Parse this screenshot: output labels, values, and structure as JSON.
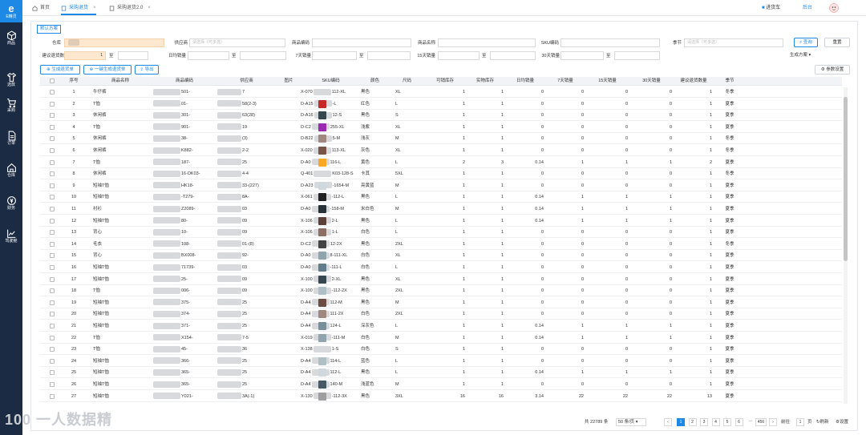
{
  "sidebar": {
    "logo_glyph": "e",
    "logo_label": "E精灵",
    "items": [
      {
        "label": "商品",
        "icon": "cube-icon"
      },
      {
        "label": "选款",
        "icon": "shirt-icon"
      },
      {
        "label": "采购",
        "icon": "cart-icon"
      },
      {
        "label": "订单",
        "icon": "document-icon"
      },
      {
        "label": "仓库",
        "icon": "home-icon"
      },
      {
        "label": "财务",
        "icon": "money-icon"
      },
      {
        "label": "驾驶舱",
        "icon": "chart-icon"
      }
    ]
  },
  "topbar": {
    "tabs": [
      {
        "label": "首页"
      },
      {
        "label": "采购退货"
      },
      {
        "label": "采购退货2.0"
      }
    ],
    "right_items": [
      "进货车",
      "后台"
    ]
  },
  "scheme_tab": "默认方案",
  "filters": {
    "warehouse_label": "仓库",
    "supplier_label": "供应商",
    "supplier_placeholder": "请选择（可多选）",
    "product_code_label": "商品编码",
    "product_name_label": "商品名称",
    "sku_label": "SKU编码",
    "season_label": "季节",
    "season_placeholder": "请选择（可多选）",
    "suggest_qty_label": "建议退货数",
    "suggest_min": "1",
    "range_sep": "至",
    "daily_sales_label": "日均销量",
    "sales7_label": "7天销量",
    "sales15_label": "15天销量",
    "sales30_label": "30天销量"
  },
  "buttons": {
    "search": "查询",
    "reset": "重置",
    "generate_plan": "生成方案",
    "generate_order": "生成退货单",
    "generate_one_click": "一键生成退货单",
    "export": "导出",
    "param_settings": "参数设置"
  },
  "table": {
    "headers": [
      "序号",
      "商品名称",
      "商品编码",
      "供应商",
      "图片",
      "SKU编码",
      "颜色",
      "尺码",
      "可销库存",
      "实物库存",
      "日均销量",
      "7天销量",
      "15天销量",
      "30天销量",
      "建议退货数量",
      "季节"
    ],
    "rows": [
      {
        "no": "1",
        "name": "牛仔裤",
        "code": "501-",
        "supplier": "7",
        "sku_pre": "X-070",
        "sku_suf": "112-XL",
        "color": "黑色",
        "size": "XL",
        "avail": "1",
        "phys": "1",
        "daily": "0",
        "s7": "0",
        "s15": "0",
        "s30": "0",
        "suggest": "1",
        "season": "冬季"
      },
      {
        "no": "2",
        "name": "T恤",
        "code": "01-",
        "supplier": "58(2-3)",
        "sku_pre": "D-A15",
        "sku_suf": "-L",
        "color": "红色",
        "size": "L",
        "avail": "1",
        "phys": "1",
        "daily": "0",
        "s7": "0",
        "s15": "0",
        "s30": "0",
        "suggest": "1",
        "season": "夏季"
      },
      {
        "no": "3",
        "name": "休闲裤",
        "code": "301-",
        "supplier": "63(28)",
        "sku_pre": "D-A16",
        "sku_suf": "12-S",
        "color": "黑色",
        "size": "S",
        "avail": "1",
        "phys": "1",
        "daily": "0",
        "s7": "0",
        "s15": "0",
        "s30": "0",
        "suggest": "1",
        "season": "夏季"
      },
      {
        "no": "4",
        "name": "T恤",
        "code": "901-",
        "supplier": "19",
        "sku_pre": "D-C2",
        "sku_suf": "255-XL",
        "color": "浅紫",
        "size": "XL",
        "avail": "1",
        "phys": "1",
        "daily": "0",
        "s7": "0",
        "s15": "0",
        "s30": "0",
        "suggest": "1",
        "season": "夏季"
      },
      {
        "no": "5",
        "name": "休闲裤",
        "code": "38-",
        "supplier": "(3)",
        "sku_pre": "D-B22",
        "sku_suf": "5-M",
        "color": "浅灰",
        "size": "M",
        "avail": "1",
        "phys": "1",
        "daily": "0",
        "s7": "0",
        "s15": "0",
        "s30": "0",
        "suggest": "1",
        "season": "冬季"
      },
      {
        "no": "6",
        "name": "休闲裤",
        "code": "K882-",
        "supplier": "2-2",
        "sku_pre": "X-020",
        "sku_suf": "113-XL",
        "color": "灰色",
        "size": "XL",
        "avail": "1",
        "phys": "1",
        "daily": "0",
        "s7": "0",
        "s15": "0",
        "s30": "0",
        "suggest": "1",
        "season": "冬季"
      },
      {
        "no": "7",
        "name": "T恤",
        "code": "187-",
        "supplier": "25",
        "sku_pre": "D-A0",
        "sku_suf": "116-L",
        "color": "黄色",
        "size": "L",
        "avail": "2",
        "phys": "3",
        "daily": "0.14",
        "s7": "1",
        "s15": "1",
        "s30": "1",
        "suggest": "2",
        "season": "夏季"
      },
      {
        "no": "8",
        "name": "休闲裤",
        "code": "16-DK03-",
        "supplier": "4-4",
        "sku_pre": "Q-401",
        "sku_suf": "K03-128-S",
        "color": "卡其",
        "size": "5XL",
        "avail": "1",
        "phys": "1",
        "daily": "0",
        "s7": "0",
        "s15": "0",
        "s30": "0",
        "suggest": "1",
        "season": "冬季"
      },
      {
        "no": "9",
        "name": "短袖T恤",
        "code": "HK18-",
        "supplier": "33-(227)",
        "sku_pre": "D-A23",
        "sku_suf": "-1654-M",
        "color": "亮黄蓝",
        "size": "M",
        "avail": "1",
        "phys": "1",
        "daily": "0",
        "s7": "0",
        "s15": "0",
        "s30": "0",
        "suggest": "1",
        "season": "夏季"
      },
      {
        "no": "10",
        "name": "短袖T恤",
        "code": "-T279-",
        "supplier": "8A-",
        "sku_pre": "X-061",
        "sku_suf": "-112-L",
        "color": "黑色",
        "size": "L",
        "avail": "1",
        "phys": "1",
        "daily": "0.14",
        "s7": "1",
        "s15": "1",
        "s30": "1",
        "suggest": "1",
        "season": "夏季"
      },
      {
        "no": "11",
        "name": "衬衫",
        "code": "Z2089-",
        "supplier": "03",
        "sku_pre": "D-A0",
        "sku_suf": "-158-M",
        "color": "米白色",
        "size": "M",
        "avail": "1",
        "phys": "1",
        "daily": "0.14",
        "s7": "1",
        "s15": "1",
        "s30": "1",
        "suggest": "1",
        "season": "夏季"
      },
      {
        "no": "12",
        "name": "短袖T恤",
        "code": "80-",
        "supplier": "09",
        "sku_pre": "X-106",
        "sku_suf": "2-L",
        "color": "黑色",
        "size": "L",
        "avail": "1",
        "phys": "1",
        "daily": "0.14",
        "s7": "1",
        "s15": "1",
        "s30": "1",
        "suggest": "1",
        "season": "夏季"
      },
      {
        "no": "13",
        "name": "背心",
        "code": "10-",
        "supplier": "09",
        "sku_pre": "X-106",
        "sku_suf": "1-L",
        "color": "白色",
        "size": "L",
        "avail": "1",
        "phys": "1",
        "daily": "0",
        "s7": "0",
        "s15": "0",
        "s30": "0",
        "suggest": "1",
        "season": "夏季"
      },
      {
        "no": "14",
        "name": "毛衣",
        "code": "108-",
        "supplier": "01-(8)",
        "sku_pre": "D-C2",
        "sku_suf": "12-2X",
        "color": "黑色",
        "size": "2XL",
        "avail": "1",
        "phys": "1",
        "daily": "0",
        "s7": "0",
        "s15": "0",
        "s30": "0",
        "suggest": "1",
        "season": "冬季"
      },
      {
        "no": "15",
        "name": "背心",
        "code": "BX008-",
        "supplier": "92-",
        "sku_pre": "D-A0",
        "sku_suf": "8-111-XL",
        "color": "白色",
        "size": "XL",
        "avail": "1",
        "phys": "1",
        "daily": "0",
        "s7": "0",
        "s15": "0",
        "s30": "0",
        "suggest": "1",
        "season": "夏季"
      },
      {
        "no": "16",
        "name": "短袖T恤",
        "code": "71739-",
        "supplier": "03",
        "sku_pre": "D-A0",
        "sku_suf": "-111-L",
        "color": "白色",
        "size": "L",
        "avail": "1",
        "phys": "1",
        "daily": "0",
        "s7": "0",
        "s15": "0",
        "s30": "0",
        "suggest": "1",
        "season": "夏季"
      },
      {
        "no": "17",
        "name": "短袖T恤",
        "code": "25-",
        "supplier": "09",
        "sku_pre": "X-100",
        "sku_suf": "2-XL",
        "color": "黑色",
        "size": "XL",
        "avail": "1",
        "phys": "1",
        "daily": "0",
        "s7": "0",
        "s15": "0",
        "s30": "0",
        "suggest": "1",
        "season": "夏季"
      },
      {
        "no": "18",
        "name": "T恤",
        "code": "006-",
        "supplier": "09",
        "sku_pre": "X-100",
        "sku_suf": "-112-2X",
        "color": "黑色",
        "size": "2XL",
        "avail": "1",
        "phys": "1",
        "daily": "0",
        "s7": "0",
        "s15": "0",
        "s30": "0",
        "suggest": "1",
        "season": "夏季"
      },
      {
        "no": "19",
        "name": "短袖T恤",
        "code": "375-",
        "supplier": "25",
        "sku_pre": "D-A4",
        "sku_suf": "112-M",
        "color": "黑色",
        "size": "M",
        "avail": "1",
        "phys": "1",
        "daily": "0",
        "s7": "0",
        "s15": "0",
        "s30": "0",
        "suggest": "1",
        "season": "夏季"
      },
      {
        "no": "20",
        "name": "短袖T恤",
        "code": "374-",
        "supplier": "25",
        "sku_pre": "D-A4",
        "sku_suf": "111-2X",
        "color": "白色",
        "size": "2XL",
        "avail": "1",
        "phys": "1",
        "daily": "0",
        "s7": "0",
        "s15": "0",
        "s30": "0",
        "suggest": "1",
        "season": "夏季"
      },
      {
        "no": "21",
        "name": "短袖T恤",
        "code": "371-",
        "supplier": "25",
        "sku_pre": "D-A4",
        "sku_suf": "124-L",
        "color": "深灰色",
        "size": "L",
        "avail": "1",
        "phys": "1",
        "daily": "0.14",
        "s7": "1",
        "s15": "1",
        "s30": "1",
        "suggest": "1",
        "season": "夏季"
      },
      {
        "no": "22",
        "name": "T恤",
        "code": "X154-",
        "supplier": "7-5",
        "sku_pre": "X-019",
        "sku_suf": "-111-M",
        "color": "白色",
        "size": "M",
        "avail": "1",
        "phys": "1",
        "daily": "0.14",
        "s7": "1",
        "s15": "1",
        "s30": "1",
        "suggest": "1",
        "season": "夏季"
      },
      {
        "no": "23",
        "name": "T恤",
        "code": "45-",
        "supplier": "36",
        "sku_pre": "X-138",
        "sku_suf": "1-S",
        "color": "白色",
        "size": "S",
        "avail": "1",
        "phys": "1",
        "daily": "0",
        "s7": "0",
        "s15": "0",
        "s30": "0",
        "suggest": "1",
        "season": "夏季"
      },
      {
        "no": "24",
        "name": "短袖T恤",
        "code": "366-",
        "supplier": "25",
        "sku_pre": "D-A4",
        "sku_suf": "114-L",
        "color": "蓝色",
        "size": "L",
        "avail": "1",
        "phys": "1",
        "daily": "0",
        "s7": "0",
        "s15": "0",
        "s30": "0",
        "suggest": "1",
        "season": "夏季"
      },
      {
        "no": "25",
        "name": "短袖T恤",
        "code": "365-",
        "supplier": "25",
        "sku_pre": "D-A4",
        "sku_suf": "112-L",
        "color": "黑色",
        "size": "L",
        "avail": "1",
        "phys": "1",
        "daily": "0.14",
        "s7": "1",
        "s15": "1",
        "s30": "1",
        "suggest": "1",
        "season": "夏季"
      },
      {
        "no": "26",
        "name": "短袖T恤",
        "code": "365-",
        "supplier": "25",
        "sku_pre": "D-A4",
        "sku_suf": "140-M",
        "color": "浅蓝色",
        "size": "M",
        "avail": "1",
        "phys": "1",
        "daily": "0",
        "s7": "0",
        "s15": "0",
        "s30": "0",
        "suggest": "1",
        "season": "夏季"
      },
      {
        "no": "27",
        "name": "短袖T恤",
        "code": "Y021-",
        "supplier": "3A(-1)",
        "sku_pre": "X-130",
        "sku_suf": "-112-3X",
        "color": "黑色",
        "size": "3XL",
        "avail": "16",
        "phys": "16",
        "daily": "3.14",
        "s7": "22",
        "s15": "22",
        "s30": "22",
        "suggest": "13",
        "season": "夏季"
      }
    ]
  },
  "pagination": {
    "total": "共 22789 条",
    "page_size": "50 条/页",
    "pages": [
      "1",
      "2",
      "3",
      "4",
      "5",
      "6"
    ],
    "ellipsis": "···",
    "last_page": "456",
    "goto_label": "前往",
    "goto_value": "1",
    "page_unit": "页",
    "refresh": "刷新",
    "settings": "设置"
  },
  "watermark": "100 一人数据精",
  "colors": {
    "sidebar": "#1b2b44",
    "accent": "#1e88e5",
    "active_page": "#1e88e5"
  }
}
